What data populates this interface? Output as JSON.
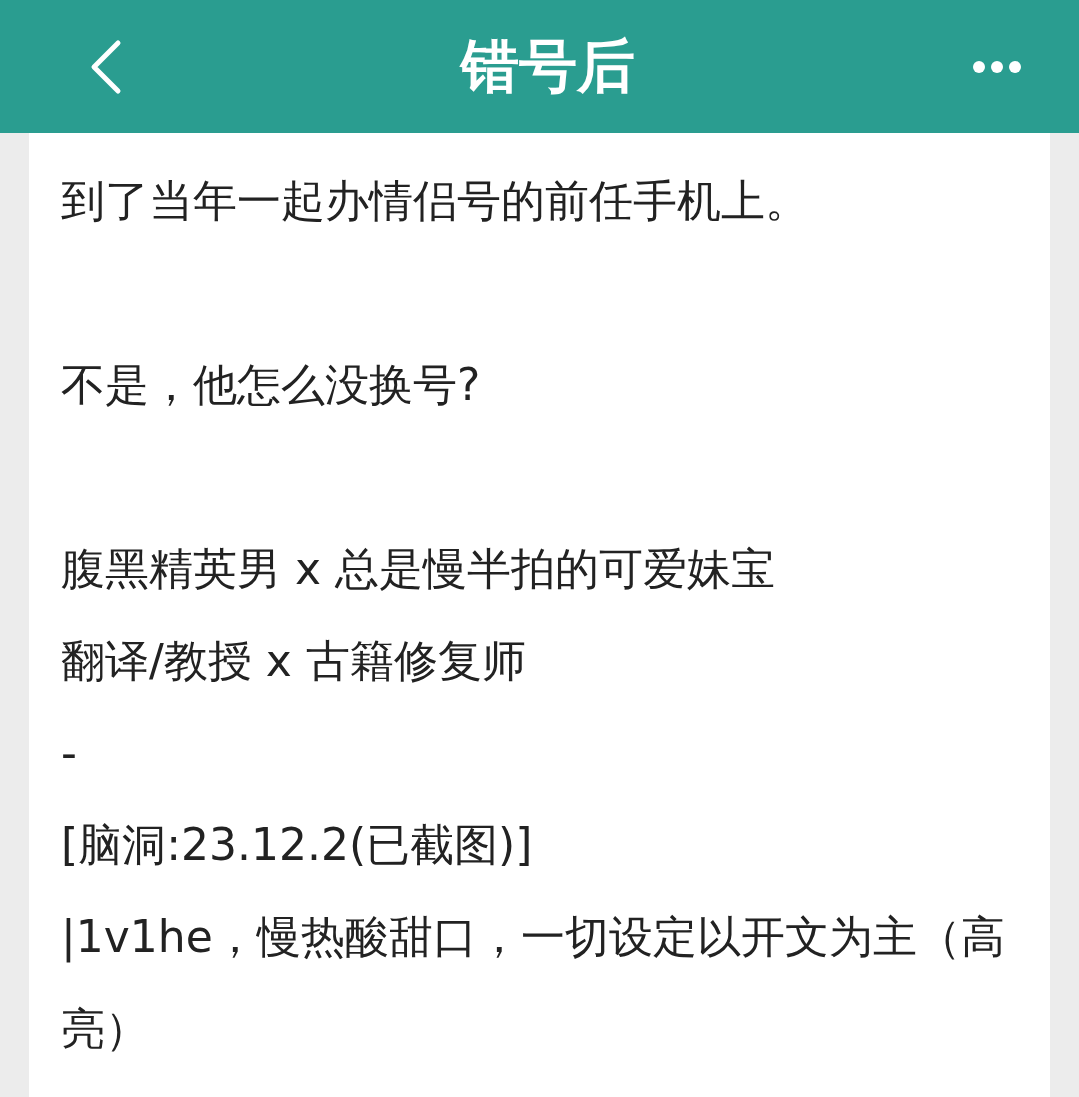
{
  "header": {
    "title": "错号后"
  },
  "paragraphs": [
    {
      "lines": [
        "到了当年一起办情侣号的前任手机上。"
      ]
    },
    {
      "lines": [
        "不是，他怎么没换号?"
      ]
    },
    {
      "lines": [
        "腹黑精英男 x 总是慢半拍的可爱妹宝",
        "翻译/教授 x 古籍修复师",
        "-",
        "[脑洞:23.12.2(已截图)]",
        "|1v1he，慢热酸甜口，一切设定以开文为主（高亮）"
      ]
    }
  ]
}
